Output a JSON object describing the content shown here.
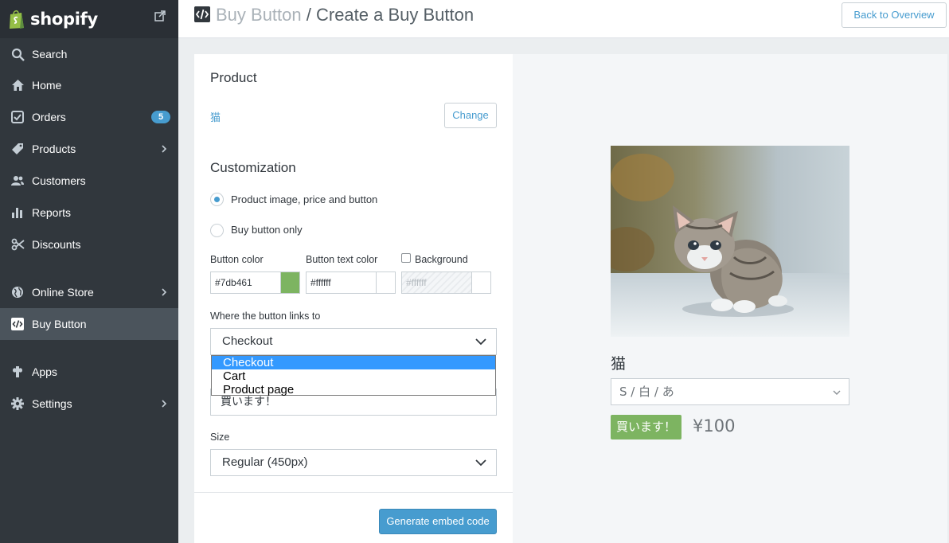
{
  "brand": {
    "name": "shopify"
  },
  "sidebar": {
    "items": [
      {
        "label": "Search",
        "icon": "search-icon"
      },
      {
        "label": "Home",
        "icon": "home-icon"
      },
      {
        "label": "Orders",
        "icon": "orders-icon",
        "badge": "5"
      },
      {
        "label": "Products",
        "icon": "tag-icon"
      },
      {
        "label": "Customers",
        "icon": "customers-icon"
      },
      {
        "label": "Reports",
        "icon": "reports-icon"
      },
      {
        "label": "Discounts",
        "icon": "discounts-icon"
      },
      {
        "label": "Online Store",
        "icon": "globe-icon"
      },
      {
        "label": "Buy Button",
        "icon": "code-icon"
      },
      {
        "label": "Apps",
        "icon": "apps-icon"
      },
      {
        "label": "Settings",
        "icon": "gear-icon"
      }
    ]
  },
  "header": {
    "crumb_parent": "Buy Button",
    "crumb_separator": " / ",
    "crumb_current": "Create a Buy Button",
    "back_label": "Back to Overview"
  },
  "form": {
    "product_heading": "Product",
    "product_name": "猫",
    "change_label": "Change",
    "customization_heading": "Customization",
    "radio_full": "Product image, price and button",
    "radio_button_only": "Buy button only",
    "button_color_label": "Button color",
    "button_color_value": "#7db461",
    "button_text_color_label": "Button text color",
    "button_text_color_value": "#ffffff",
    "background_label": "Background",
    "background_value": "#ffffff",
    "link_label": "Where the button links to",
    "link_selected": "Checkout",
    "link_options": [
      "Checkout",
      "Cart",
      "Product page"
    ],
    "button_text_value": "買います！",
    "size_label": "Size",
    "size_selected": "Regular (450px)",
    "generate_label": "Generate embed code"
  },
  "preview": {
    "title": "猫",
    "variant": "S / 白 / あ",
    "buy_label": "買います！",
    "price": "¥100"
  },
  "colors": {
    "sidebar_bg": "#31373d",
    "accent": "#479ccf",
    "button_color": "#7db461"
  }
}
